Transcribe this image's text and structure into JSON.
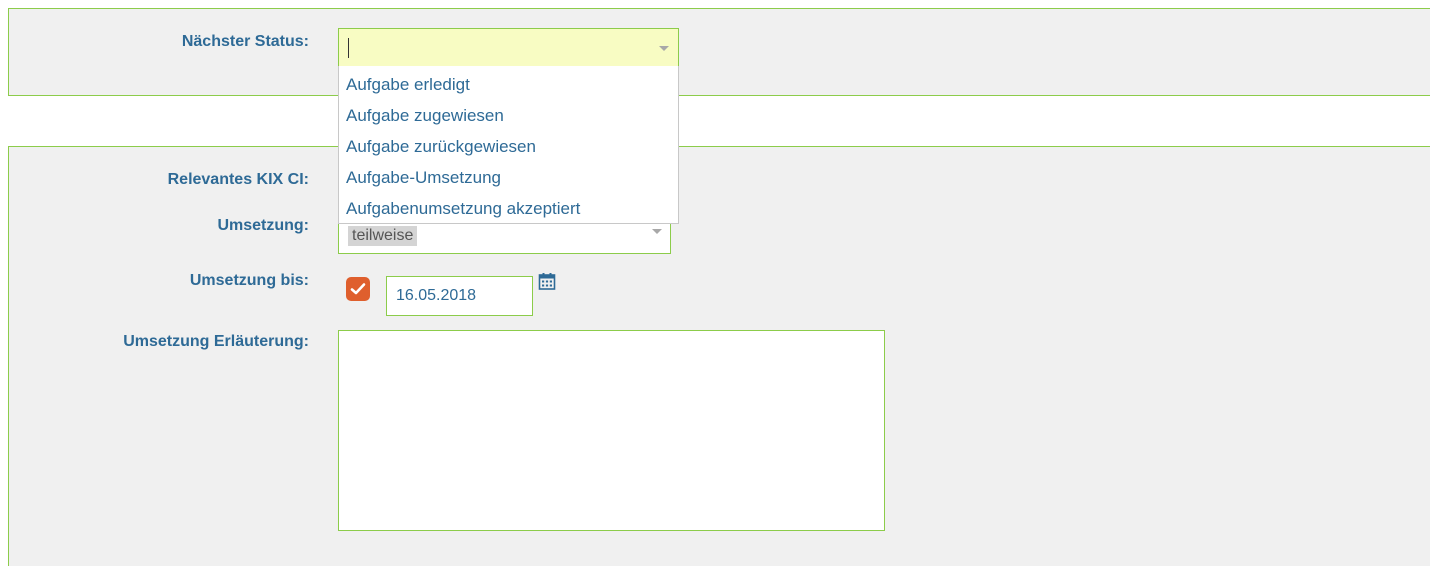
{
  "next_status": {
    "label": "Nächster Status:",
    "value": "",
    "options": [
      "Aufgabe erledigt",
      "Aufgabe zugewiesen",
      "Aufgabe zurückgewiesen",
      "Aufgabe-Umsetzung",
      "Aufgabenumsetzung akzeptiert"
    ]
  },
  "form": {
    "relevant_ci_label": "Relevantes KIX CI:",
    "umsetzung_label": "Umsetzung:",
    "umsetzung_value": "teilweise",
    "umsetzung_bis_label": "Umsetzung bis:",
    "umsetzung_bis_checked": true,
    "umsetzung_bis_date": "16.05.2018",
    "erlaeuterung_label": "Umsetzung Erläuterung:",
    "erlaeuterung_value": ""
  },
  "colors": {
    "accent_border": "#8ccc4a",
    "label_text": "#2e6a96",
    "checkbox": "#df5f2d",
    "select_focus_bg": "#f8fcc3"
  },
  "icons": [
    "chevron-down-icon",
    "check-icon",
    "calendar-icon"
  ]
}
